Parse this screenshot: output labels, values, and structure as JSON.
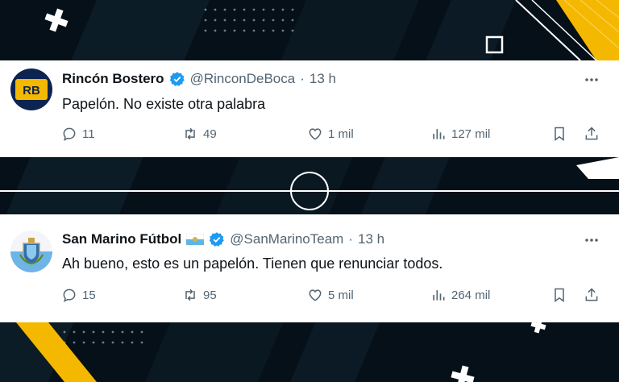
{
  "tweets": [
    {
      "name": "Rincón Bostero",
      "handle": "@RinconDeBoca",
      "separator": "·",
      "time": "13 h",
      "text": "Papelón. No existe otra palabra",
      "avatar": "rincon-bostero-logo",
      "avatar_initials": "RB",
      "replies": "11",
      "retweets": "49",
      "likes": "1 mil",
      "views": "127 mil"
    },
    {
      "name": "San Marino Fútbol",
      "handle": "@SanMarinoTeam",
      "separator": "·",
      "time": "13 h",
      "text": "Ah bueno, esto es un papelón. Tienen que renunciar todos.",
      "avatar": "san-marino-crest",
      "replies": "15",
      "retweets": "95",
      "likes": "5 mil",
      "views": "264 mil"
    }
  ],
  "icons": {
    "verified": "verified-badge-icon",
    "reply": "reply-icon",
    "retweet": "retweet-icon",
    "like": "like-icon",
    "views": "views-icon",
    "bookmark": "bookmark-icon",
    "share": "share-icon",
    "more": "more-icon"
  },
  "colors": {
    "background": "#061018",
    "accent_yellow": "#f5b800",
    "verified_blue": "#1d9bf0",
    "text_primary": "#0f1419",
    "text_secondary": "#536471"
  }
}
